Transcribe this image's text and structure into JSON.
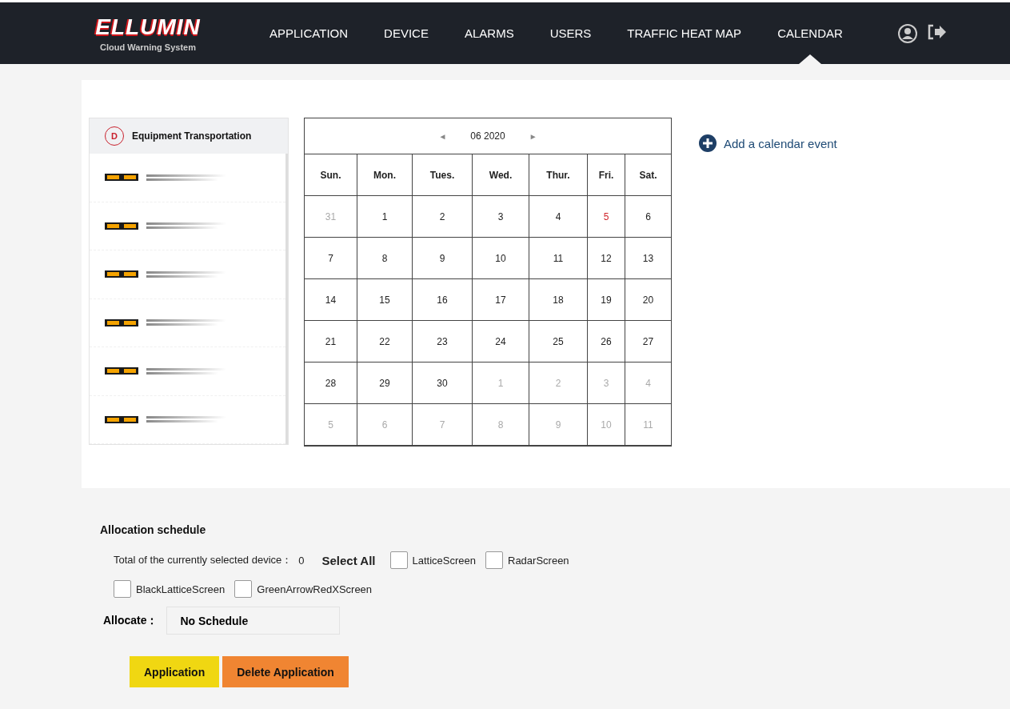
{
  "header": {
    "logo": "ELLUMIN",
    "tagline": "Cloud Warning System",
    "nav": [
      {
        "label": "APPLICATION",
        "selected": false
      },
      {
        "label": "DEVICE",
        "selected": false
      },
      {
        "label": "ALARMS",
        "selected": false
      },
      {
        "label": "USERS",
        "selected": false
      },
      {
        "label": "TRAFFIC HEAT MAP",
        "selected": false
      },
      {
        "label": "CALENDAR",
        "selected": true
      }
    ]
  },
  "device_list": {
    "group": {
      "badge": "D",
      "title": "Equipment Transportation"
    },
    "items": [
      {
        "kind": "light-bar"
      },
      {
        "kind": "light-bar"
      },
      {
        "kind": "light-bar"
      },
      {
        "kind": "light-bar"
      },
      {
        "kind": "light-bar"
      },
      {
        "kind": "light-bar"
      }
    ]
  },
  "calendar": {
    "month": "06 2020",
    "prev": "◄",
    "next": "►",
    "weekdays": [
      "Sun.",
      "Mon.",
      "Tues.",
      "Wed.",
      "Thur.",
      "Fri.",
      "Sat."
    ],
    "weeks": [
      [
        {
          "day": "31",
          "other_month": true,
          "marked": false
        },
        {
          "day": "1",
          "other_month": false,
          "marked": false
        },
        {
          "day": "2",
          "other_month": false,
          "marked": false
        },
        {
          "day": "3",
          "other_month": false,
          "marked": false
        },
        {
          "day": "4",
          "other_month": false,
          "marked": false
        },
        {
          "day": "5",
          "other_month": false,
          "marked": true
        },
        {
          "day": "6",
          "other_month": false,
          "marked": false
        }
      ],
      [
        {
          "day": "7",
          "other_month": false,
          "marked": false
        },
        {
          "day": "8",
          "other_month": false,
          "marked": false
        },
        {
          "day": "9",
          "other_month": false,
          "marked": false
        },
        {
          "day": "10",
          "other_month": false,
          "marked": false
        },
        {
          "day": "11",
          "other_month": false,
          "marked": false
        },
        {
          "day": "12",
          "other_month": false,
          "marked": false
        },
        {
          "day": "13",
          "other_month": false,
          "marked": false
        }
      ],
      [
        {
          "day": "14",
          "other_month": false,
          "marked": false
        },
        {
          "day": "15",
          "other_month": false,
          "marked": false
        },
        {
          "day": "16",
          "other_month": false,
          "marked": false
        },
        {
          "day": "17",
          "other_month": false,
          "marked": false
        },
        {
          "day": "18",
          "other_month": false,
          "marked": false
        },
        {
          "day": "19",
          "other_month": false,
          "marked": false
        },
        {
          "day": "20",
          "other_month": false,
          "marked": false
        }
      ],
      [
        {
          "day": "21",
          "other_month": false,
          "marked": false
        },
        {
          "day": "22",
          "other_month": false,
          "marked": false
        },
        {
          "day": "23",
          "other_month": false,
          "marked": false
        },
        {
          "day": "24",
          "other_month": false,
          "marked": false
        },
        {
          "day": "25",
          "other_month": false,
          "marked": false
        },
        {
          "day": "26",
          "other_month": false,
          "marked": false
        },
        {
          "day": "27",
          "other_month": false,
          "marked": false
        }
      ],
      [
        {
          "day": "28",
          "other_month": false,
          "marked": false
        },
        {
          "day": "29",
          "other_month": false,
          "marked": false
        },
        {
          "day": "30",
          "other_month": false,
          "marked": false
        },
        {
          "day": "1",
          "other_month": true,
          "marked": false
        },
        {
          "day": "2",
          "other_month": true,
          "marked": false
        },
        {
          "day": "3",
          "other_month": true,
          "marked": false
        },
        {
          "day": "4",
          "other_month": true,
          "marked": false
        }
      ],
      [
        {
          "day": "5",
          "other_month": true,
          "marked": false
        },
        {
          "day": "6",
          "other_month": true,
          "marked": false
        },
        {
          "day": "7",
          "other_month": true,
          "marked": false
        },
        {
          "day": "8",
          "other_month": true,
          "marked": false
        },
        {
          "day": "9",
          "other_month": true,
          "marked": false
        },
        {
          "day": "10",
          "other_month": true,
          "marked": false
        },
        {
          "day": "11",
          "other_month": true,
          "marked": false
        }
      ]
    ]
  },
  "add_event": "Add a calendar event",
  "allocation": {
    "title": "Allocation schedule",
    "total_label": "Total of the currently selected device：",
    "total_value": "0",
    "select_all": "Select All",
    "options": [
      {
        "label": "LatticeScreen",
        "checked": false
      },
      {
        "label": "RadarScreen",
        "checked": false
      },
      {
        "label": "BlackLatticeScreen",
        "checked": false
      },
      {
        "label": "GreenArrowRedXScreen",
        "checked": false
      }
    ],
    "allocate_label": "Allocate：",
    "allocate_value": "No Schedule"
  },
  "buttons": [
    {
      "label": "Application",
      "kind": "primary"
    },
    {
      "label": "Delete Application",
      "kind": "danger"
    }
  ]
}
